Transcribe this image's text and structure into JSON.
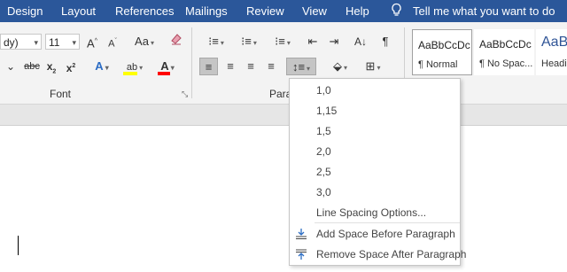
{
  "tabs": [
    "Design",
    "Layout",
    "References",
    "Mailings",
    "Review",
    "View",
    "Help"
  ],
  "tell_me": "Tell me what you want to do",
  "font": {
    "name": "dy)",
    "size": "11"
  },
  "groups": {
    "font": "Font",
    "paragraph": "Para"
  },
  "styles": [
    {
      "sample": "AaBbCcDc",
      "name": "¶ Normal"
    },
    {
      "sample": "AaBbCcDc",
      "name": "¶ No Spac..."
    },
    {
      "sample": "AaB",
      "name": "Headi"
    }
  ],
  "line_spacing_menu": {
    "options": [
      "1,0",
      "1,15",
      "1,5",
      "2,0",
      "2,5",
      "3,0"
    ],
    "more_options": "Line Spacing Options...",
    "add_before": "Add Space Before Paragraph",
    "remove_after": "Remove Space After Paragraph"
  },
  "colors": {
    "tab_bar": "#2b579a",
    "highlight": "#ffff00",
    "font_color": "#ff0000"
  }
}
